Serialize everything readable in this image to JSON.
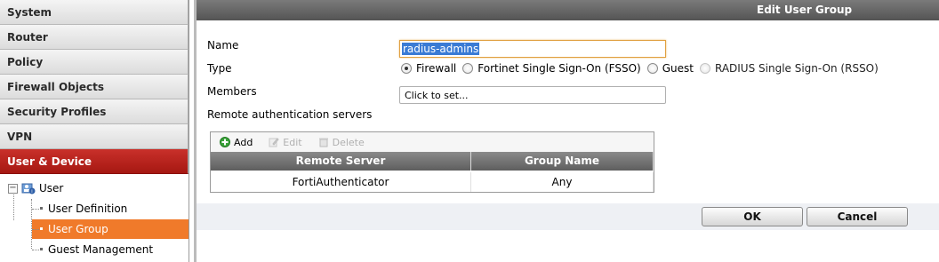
{
  "sidebar": {
    "items": [
      {
        "label": "System"
      },
      {
        "label": "Router"
      },
      {
        "label": "Policy"
      },
      {
        "label": "Firewall Objects"
      },
      {
        "label": "Security Profiles"
      },
      {
        "label": "VPN"
      },
      {
        "label": "User & Device"
      }
    ],
    "tree": {
      "toggle": "−",
      "root_label": "User",
      "children": [
        {
          "label": "User Definition"
        },
        {
          "label": "User Group"
        },
        {
          "label": "Guest Management"
        }
      ]
    }
  },
  "dialog": {
    "title": "Edit User Group",
    "name_label": "Name",
    "name_value": "radius-admins",
    "type_label": "Type",
    "type_options": [
      {
        "label": "Firewall",
        "checked": true
      },
      {
        "label": "Fortinet Single Sign-On (FSSO)",
        "checked": false
      },
      {
        "label": "Guest",
        "checked": false
      },
      {
        "label": "RADIUS Single Sign-On (RSSO)",
        "checked": false,
        "disabled": true
      }
    ],
    "members_label": "Members",
    "members_value": "Click to set...",
    "remote_auth_label": "Remote authentication servers",
    "toolbar": {
      "add": "Add",
      "edit": "Edit",
      "delete": "Delete"
    },
    "table": {
      "columns": [
        "Remote Server",
        "Group Name"
      ],
      "rows": [
        [
          "FortiAuthenticator",
          "Any"
        ]
      ]
    },
    "ok_label": "OK",
    "cancel_label": "Cancel"
  },
  "colors": {
    "active_nav": "#b0221b",
    "selected_tree": "#f07a2a",
    "titlebar": "#5e5e5e"
  }
}
